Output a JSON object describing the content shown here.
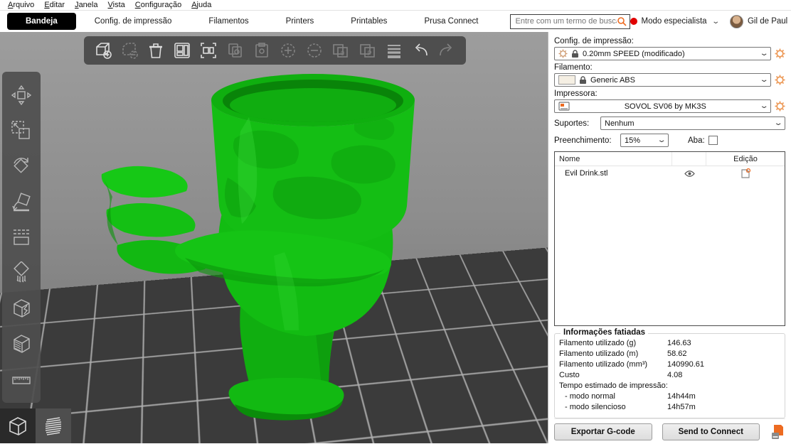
{
  "menu": {
    "items": [
      "Arquivo",
      "Editar",
      "Janela",
      "Vista",
      "Configuração",
      "Ajuda"
    ]
  },
  "tabbar": {
    "tabs": [
      {
        "label": "Bandeja",
        "active": true
      },
      {
        "label": "Config. de impressão",
        "active": false
      },
      {
        "label": "Filamentos",
        "active": false
      },
      {
        "label": "Printers",
        "active": false
      },
      {
        "label": "Printables",
        "active": false
      },
      {
        "label": "Prusa Connect",
        "active": false
      }
    ],
    "search_placeholder": "Entre com um termo de busca",
    "mode_label": "Modo especialista",
    "user_label": "Gil de Paul"
  },
  "toolbar_top": {
    "icons": [
      "add-object",
      "delete-object",
      "delete-all",
      "arrange",
      "arrange-selection",
      "copy",
      "paste",
      "add-instance",
      "remove-instance",
      "split-to-objects",
      "split-to-parts",
      "variable-layer-height",
      "undo",
      "redo"
    ]
  },
  "toolbar_left": {
    "icons": [
      "move",
      "scale",
      "rotate",
      "place-on-face",
      "cut",
      "paint-supports",
      "seam-painting",
      "multimaterial-painting",
      "measure"
    ]
  },
  "view_switch": {
    "buttons": [
      "3d-editor-view",
      "preview-view"
    ]
  },
  "panel": {
    "print_settings": {
      "label": "Config. de impressão:",
      "value": "0.20mm SPEED (modificado)"
    },
    "filament": {
      "label": "Filamento:",
      "value": "Generic ABS"
    },
    "printer": {
      "label": "Impressora:",
      "value": "SOVOL SV06 by MK3S"
    },
    "supports": {
      "label": "Suportes:",
      "value": "Nenhum"
    },
    "infill": {
      "label": "Preenchimento:",
      "value": "15%"
    },
    "brim": {
      "label": "Aba:",
      "checked": false
    },
    "object_table": {
      "col_name": "Nome",
      "col_edit": "Edição",
      "rows": [
        {
          "name": "Evil Drink.stl"
        }
      ]
    },
    "sliced_info": {
      "title": "Informações fatiadas",
      "rows": [
        {
          "label": "Filamento utilizado (g)",
          "value": "146.63"
        },
        {
          "label": "Filamento utilizado (m)",
          "value": "58.62"
        },
        {
          "label": "Filamento utilizado (mm³)",
          "value": "140990.61"
        },
        {
          "label": "Custo",
          "value": "4.08"
        }
      ],
      "time_title": "Tempo estimado de impressão:",
      "time_rows": [
        {
          "label": "- modo normal",
          "value": "14h44m"
        },
        {
          "label": "- modo silencioso",
          "value": "14h57m"
        }
      ]
    },
    "buttons": {
      "export": "Exportar G-code",
      "send": "Send to Connect"
    }
  },
  "model": {
    "name": "Evil Drink.stl"
  },
  "colors": {
    "accent_orange": "#ED6B21",
    "model_green": "#14BE14",
    "mode_dot_red": "#E00000",
    "bed_dark": "#3B3B3B",
    "tab_active_bg": "#000000"
  }
}
